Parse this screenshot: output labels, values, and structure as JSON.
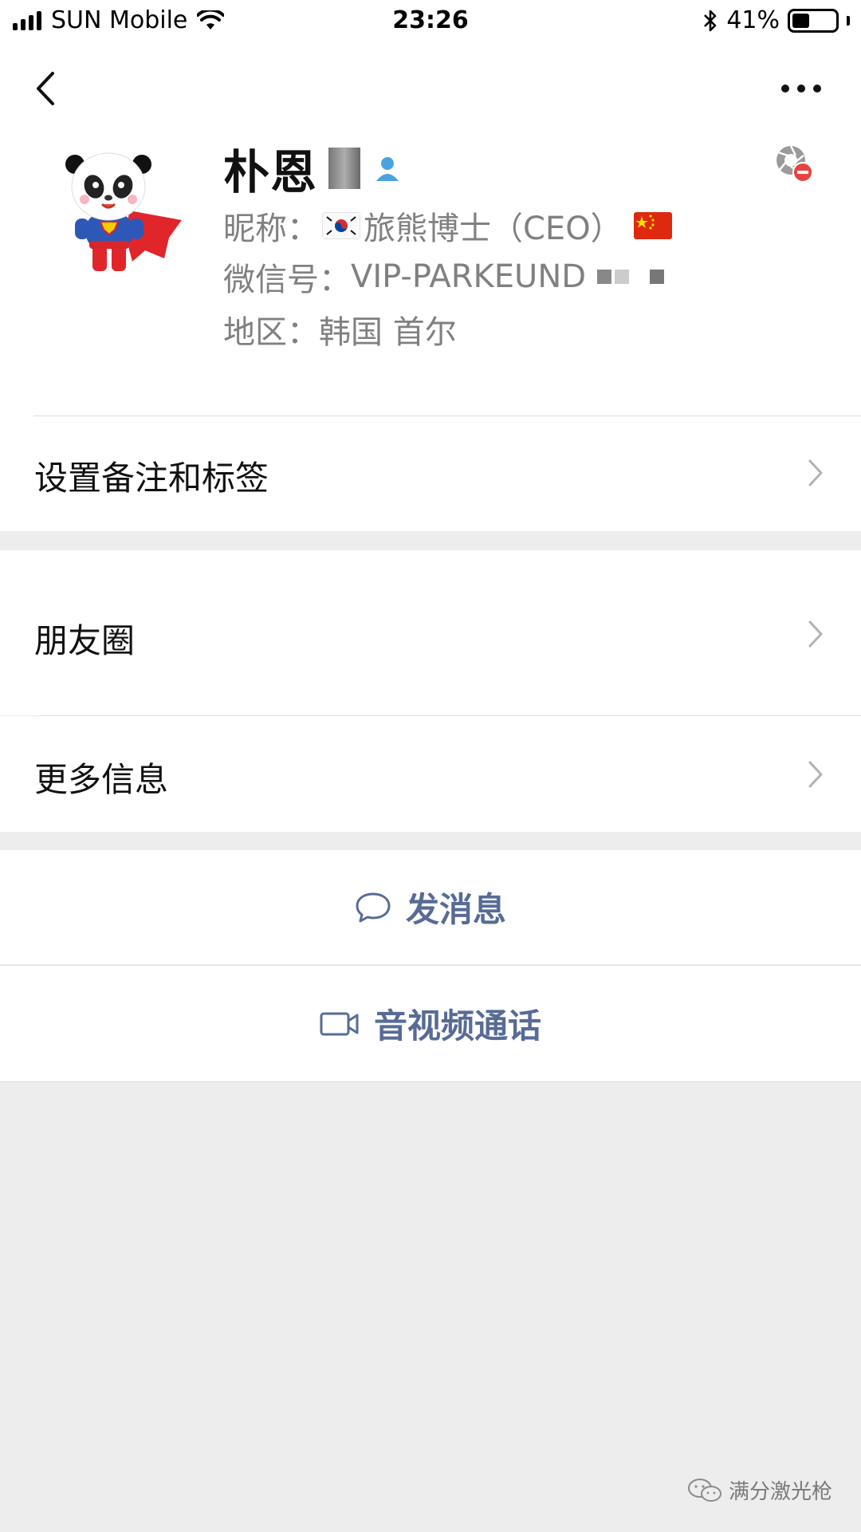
{
  "status_bar": {
    "carrier": "SUN Mobile",
    "time": "23:26",
    "battery_percent": "41%",
    "battery_level": 0.41
  },
  "nav": {
    "back_icon": "chevron-left-icon",
    "more_icon": "more-dots-icon"
  },
  "profile": {
    "name": "朴恩",
    "nickname_label": "昵称：",
    "nickname_value": "旅熊博士（CEO）",
    "wechat_id_label": "微信号：",
    "wechat_id_value": "VIP-PARKEUND",
    "region_label": "地区：",
    "region_value": "韩国 首尔",
    "icons": {
      "avatar": "panda-superhero-avatar",
      "contact_badge": "contact-person-icon",
      "star_remove": "star-friend-remove-icon",
      "flag_korea": "flag-korea-icon",
      "flag_china": "flag-china-icon"
    }
  },
  "menu": {
    "remarks_tags": "设置备注和标签",
    "moments": "朋友圈",
    "more_info": "更多信息"
  },
  "actions": {
    "send_message": "发消息",
    "video_call": "音视频通话"
  },
  "watermark": "满分激光枪",
  "colors": {
    "link_blue": "#576b95",
    "gray_text": "#808080",
    "background": "#ededed"
  }
}
